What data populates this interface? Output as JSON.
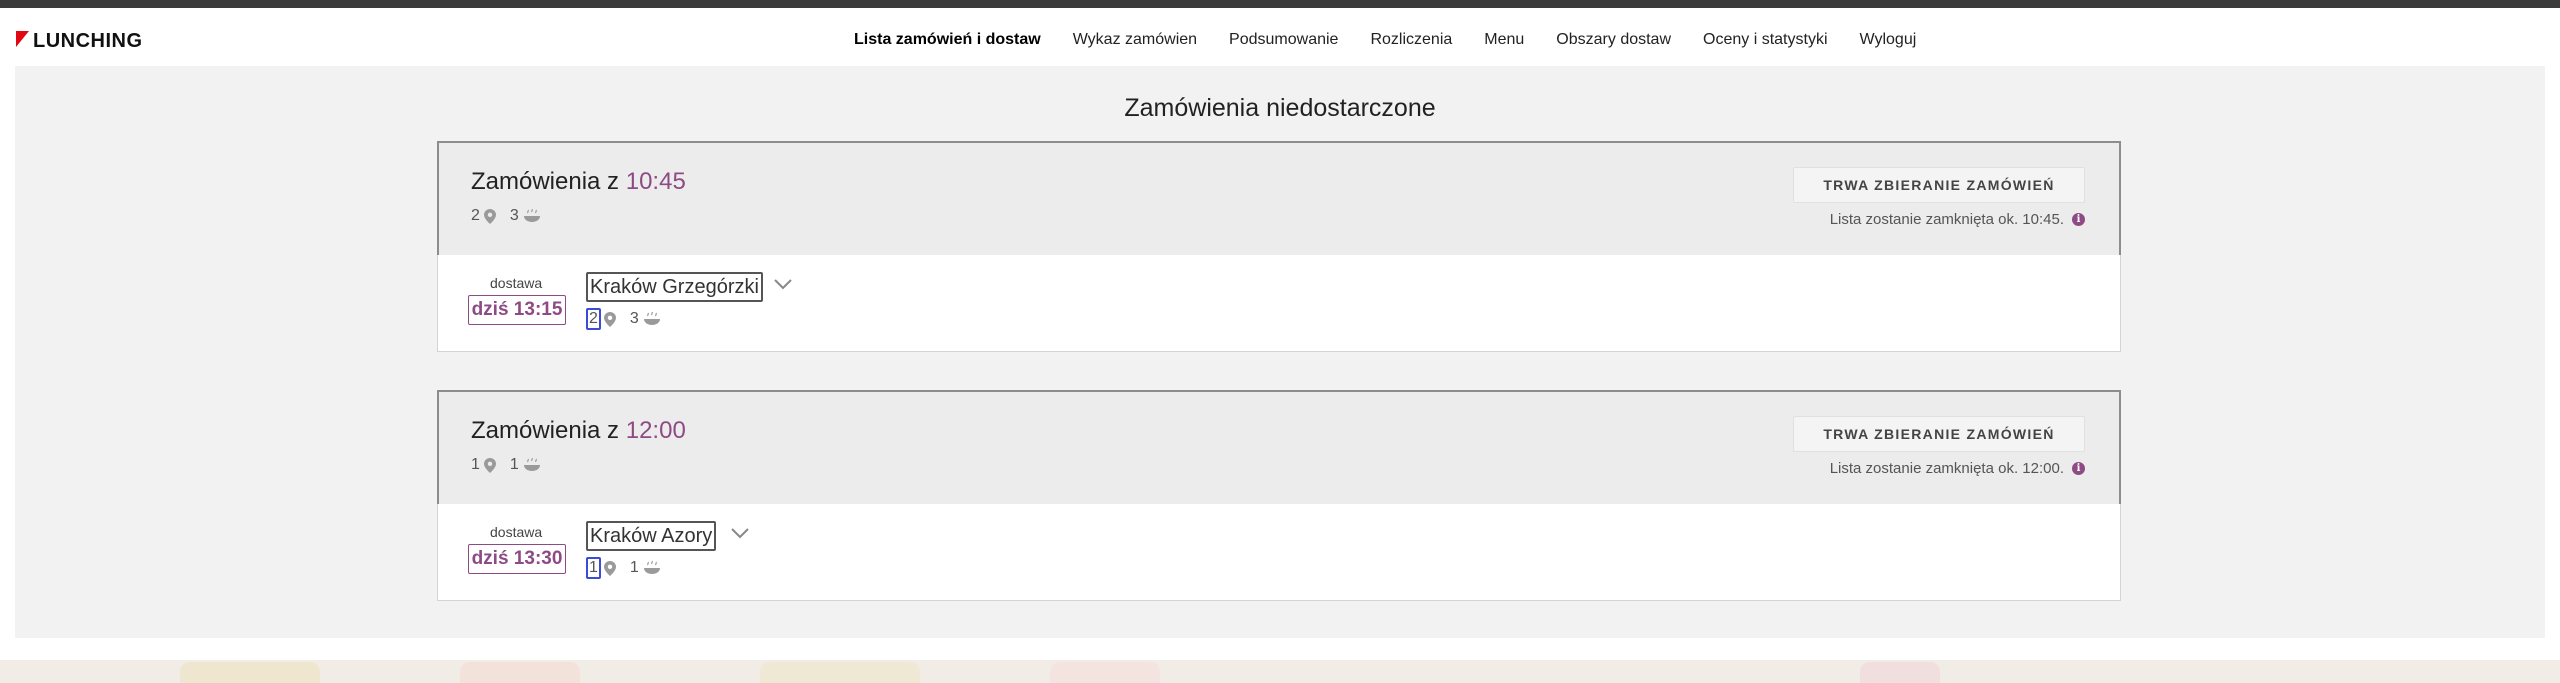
{
  "brand": {
    "logo_text": "LUNCHING",
    "accent": "#e30613"
  },
  "nav": {
    "items": [
      {
        "label": "Lista zamówień i dostaw",
        "active": true
      },
      {
        "label": "Wykaz zamówien",
        "active": false
      },
      {
        "label": "Podsumowanie",
        "active": false
      },
      {
        "label": "Rozliczenia",
        "active": false
      },
      {
        "label": "Menu",
        "active": false
      },
      {
        "label": "Obszary dostaw",
        "active": false
      },
      {
        "label": "Oceny i statystyki",
        "active": false
      },
      {
        "label": "Wyloguj",
        "active": false
      }
    ]
  },
  "page": {
    "title": "Zamówienia niedostarczone"
  },
  "colors": {
    "time_accent": "#8e4a84",
    "highlight_border": "#3a4bd8"
  },
  "groups": [
    {
      "title_prefix": "Zamówienia z",
      "time": "10:45",
      "locations": "2",
      "dishes": "3",
      "status": "TRWA ZBIERANIE ZAMÓWIEŃ",
      "close_note": "Lista zostanie zamknięta ok. 10:45.",
      "delivery": {
        "label": "dostawa",
        "time": "dziś 13:15",
        "area": "Kraków Grzegórzki",
        "locations": "2",
        "dishes": "3"
      }
    },
    {
      "title_prefix": "Zamówienia z",
      "time": "12:00",
      "locations": "1",
      "dishes": "1",
      "status": "TRWA ZBIERANIE ZAMÓWIEŃ",
      "close_note": "Lista zostanie zamknięta ok. 12:00.",
      "delivery": {
        "label": "dostawa",
        "time": "dziś 13:30",
        "area": "Kraków Azory",
        "locations": "1",
        "dishes": "1"
      }
    }
  ]
}
